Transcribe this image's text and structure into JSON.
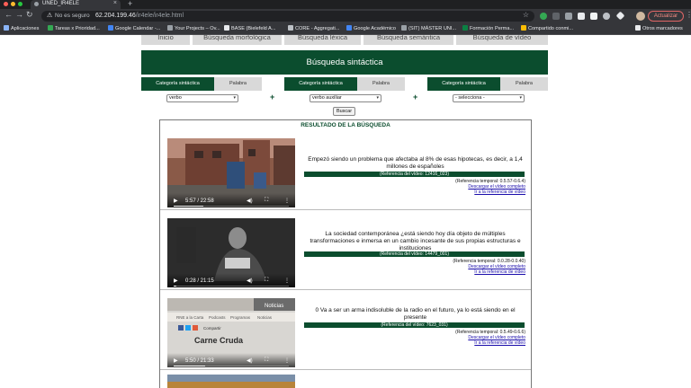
{
  "browser": {
    "tab_title": "UNED_IR4ELE",
    "close_glyph": "×",
    "new_tab_glyph": "+",
    "security_text": "No es seguro",
    "url_host": "62.204.199.46",
    "url_path": "/ir4ele/ir4ele.html",
    "update_label": "Actualizar",
    "colors": {
      "chrome_dark": "#1f2022",
      "toolbar": "#35363a",
      "omnibox": "#202124"
    }
  },
  "bookmarks": [
    {
      "label": "Aplicaciones",
      "icon": "apps-grid-icon",
      "color": "#8ab4f8"
    },
    {
      "label": "Tareas x Prioridad...",
      "icon": "green-plus-icon",
      "color": "#34a853"
    },
    {
      "label": "Google Calendar -...",
      "icon": "calendar-icon",
      "color": "#4285f4"
    },
    {
      "label": "Your Projects – Ov...",
      "icon": "circle-icon",
      "color": "#9aa0a6"
    },
    {
      "label": "BASE (Bielefeld A...",
      "icon": "doc-icon",
      "color": "#e8eaed"
    },
    {
      "label": "CORE - Aggregati...",
      "icon": "core-icon",
      "color": "#bdc1c6"
    },
    {
      "label": "Google Académico",
      "icon": "scholar-icon",
      "color": "#4285f4"
    },
    {
      "label": "(SIT) MÁSTER UNI...",
      "icon": "globe-icon",
      "color": "#9aa0a6"
    },
    {
      "label": "Formación Perma...",
      "icon": "uned-icon",
      "color": "#0b8043"
    },
    {
      "label": "Compartido conmi...",
      "icon": "drive-icon",
      "color": "#fbbc04"
    },
    {
      "label": "Otros marcadores",
      "icon": "folder-icon",
      "color": "#e8eaed"
    }
  ],
  "page": {
    "top_nav": [
      "Inicio",
      "Búsqueda morfológica",
      "Búsqueda léxica",
      "Búsqueda semántica",
      "Búsqueda de vídeo"
    ],
    "banner_title": "Búsqueda sintáctica",
    "selector_groups": [
      {
        "cat_tab": "Categoría sintáctica",
        "word_tab": "Palabra",
        "selected": "verbo"
      },
      {
        "cat_tab": "Categoría sintáctica",
        "word_tab": "Palabra",
        "selected": "verbo auxiliar"
      },
      {
        "cat_tab": "Categoría sintáctica",
        "word_tab": "Palabra",
        "selected": "- selecciona -"
      }
    ],
    "plus_sign": "+",
    "search_button": "Buscar",
    "results_title": "RESULTADO DE LA BÚSQUEDA",
    "accent_color": "#0b4d2e",
    "results": [
      {
        "video_time": "5:57 / 22:58",
        "progress": 0.26,
        "sentence": "Empezó siendo un problema que afectaba al 8% de esas hipotecas, es decir, a 1,4 millones de españoles",
        "ref": "(Referencia del vídeo: 12416_023)",
        "temporal": "(Referencia temporal: 0.5.57-0.6.4)",
        "download": "Descargar el vídeo completo",
        "goto": "Ir a la referencia de vídeo"
      },
      {
        "video_time": "0:28 / 21:15",
        "progress": 0.02,
        "sentence": "La sociedad contemporánea ¿está siendo hoy día objeto de múltiples transformaciones e inmersa en un cambio incesante de sus propias estructuras e instituciones",
        "ref": "(Referencia del vídeo: 14479_001)",
        "temporal": "(Referencia temporal: 0.0.28-0.0.40)",
        "download": "Descargar el vídeo completo",
        "goto": "Ir a la referencia de vídeo"
      },
      {
        "video_time": "5:50 / 21:33",
        "progress": 0.27,
        "sentence": "0 Va a ser un arma indisoluble de la radio en el futuro, ya lo está siendo en el presente",
        "ref": "(Referencia del vídeo: 7623_031)",
        "temporal": "(Referencia temporal: 0.5.49-0.6.6)",
        "download": "Descargar el vídeo completo",
        "goto": "Ir a la referencia de vídeo",
        "thumb_text_1": "Carne Cruda",
        "thumb_text_2": "Noticias",
        "thumb_menu": [
          "RNE a la Carta",
          "Podcasts",
          "Programas",
          "Noticias"
        ],
        "thumb_share": "Compartir"
      }
    ]
  }
}
